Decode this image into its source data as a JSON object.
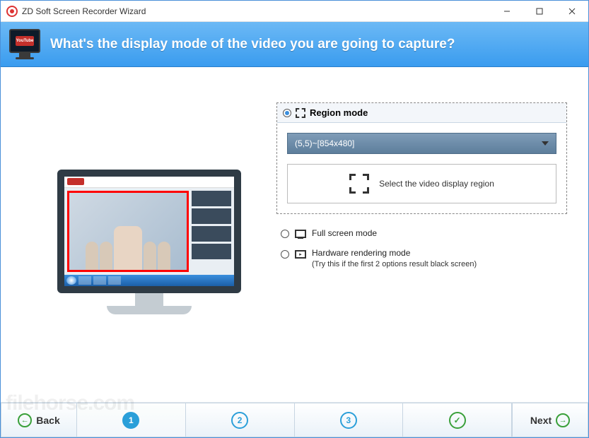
{
  "titlebar": {
    "title": "ZD Soft Screen Recorder Wizard"
  },
  "header": {
    "question": "What's the display mode of the video you are going to capture?",
    "icon_badge": "YouTube"
  },
  "options": {
    "region": {
      "label": "Region mode",
      "coords": "(5,5)~[854x480]",
      "select_button": "Select the video display region"
    },
    "fullscreen": {
      "label": "Full screen mode"
    },
    "hardware": {
      "label": "Hardware rendering mode",
      "hint": "(Try this if the first 2 options result black screen)"
    }
  },
  "footer": {
    "back": "Back",
    "next": "Next",
    "steps": [
      "1",
      "2",
      "3",
      "✓"
    ]
  },
  "watermark": "filehorse.com"
}
